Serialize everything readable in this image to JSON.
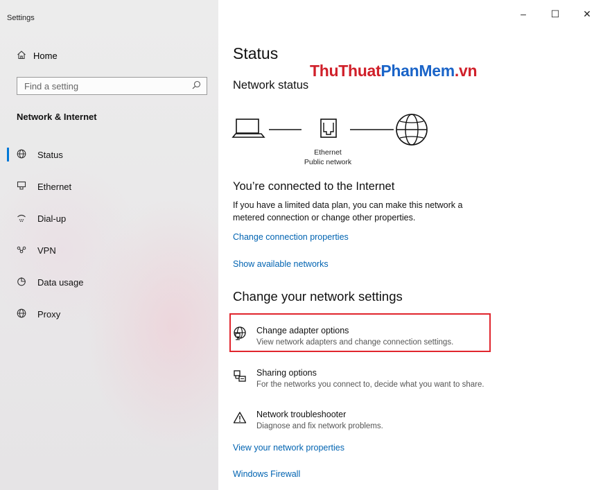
{
  "window": {
    "title": "Settings",
    "controls": {
      "minimize": "–",
      "maximize": "☐",
      "close": "✕"
    }
  },
  "sidebar": {
    "home": {
      "icon": "home-icon",
      "label": "Home"
    },
    "search": {
      "placeholder": "Find a setting",
      "icon": "search-icon"
    },
    "section_heading": "Network & Internet",
    "items": [
      {
        "label": "Status",
        "icon": "globe-icon",
        "active": true
      },
      {
        "label": "Ethernet",
        "icon": "ethernet-icon"
      },
      {
        "label": "Dial-up",
        "icon": "dialup-icon"
      },
      {
        "label": "VPN",
        "icon": "vpn-icon"
      },
      {
        "label": "Data usage",
        "icon": "data-usage-icon"
      },
      {
        "label": "Proxy",
        "icon": "globe-icon"
      }
    ]
  },
  "watermark": {
    "part1": "ThuThuat",
    "part2": "PhanMem",
    "part3": ".vn"
  },
  "main": {
    "title": "Status",
    "network_status_heading": "Network status",
    "diagram": {
      "adapter_name": "Ethernet",
      "network_type": "Public network"
    },
    "connected_heading": "You’re connected to the Internet",
    "connected_text": "If you have a limited data plan, you can make this network a metered connection or change other properties.",
    "change_connection_link": "Change connection properties",
    "show_networks_link": "Show available networks",
    "change_settings_heading": "Change your network settings",
    "options": [
      {
        "icon": "adapter-icon",
        "title": "Change adapter options",
        "subtitle": "View network adapters and change connection settings."
      },
      {
        "icon": "sharing-icon",
        "title": "Sharing options",
        "subtitle": "For the networks you connect to, decide what you want to share."
      },
      {
        "icon": "warning-icon",
        "title": "Network troubleshooter",
        "subtitle": "Diagnose and fix network problems."
      }
    ],
    "view_properties_link": "View your network properties",
    "firewall_link": "Windows Firewall"
  },
  "colors": {
    "accent": "#0078d7",
    "link": "#0063b1",
    "highlight_box": "#e0242c",
    "watermark_red": "#d0202a",
    "watermark_blue": "#1a64c8"
  }
}
